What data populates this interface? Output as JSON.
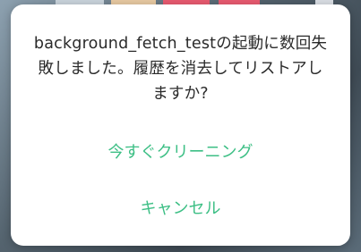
{
  "dialog": {
    "message": "background_fetch_testの起動に数回失敗しました。履歴を消去してリストアしますか?",
    "primary_action": "今すぐクリーニング",
    "secondary_action": "キャンセル"
  },
  "colors": {
    "accent": "#3dbf85",
    "text": "#2a2a2a",
    "dialog_bg": "#ffffff"
  }
}
